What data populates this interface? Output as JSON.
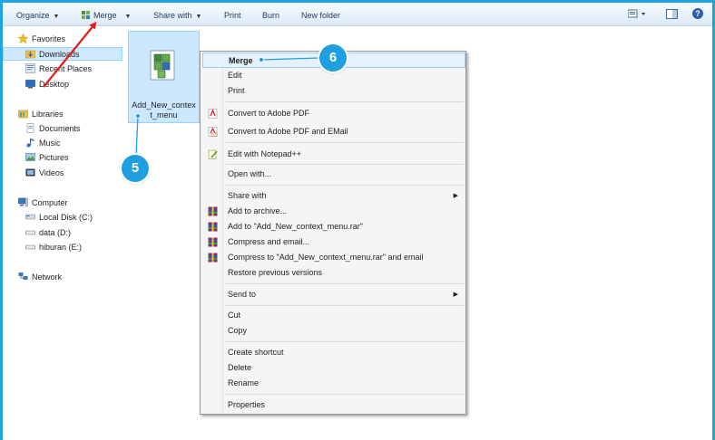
{
  "toolbar": {
    "organize_label": "Organize",
    "merge_label": "Merge",
    "share_label": "Share with",
    "print_label": "Print",
    "burn_label": "Burn",
    "newfolder_label": "New folder",
    "help_label": "?"
  },
  "nav": {
    "favorites": "Favorites",
    "downloads": "Downloads",
    "recent": "Recent Places",
    "desktop": "Desktop",
    "libraries": "Libraries",
    "documents": "Documents",
    "music": "Music",
    "pictures": "Pictures",
    "videos": "Videos",
    "computer": "Computer",
    "localdisk": "Local Disk (C:)",
    "data": "data (D:)",
    "hiburan": "hiburan (E:)",
    "network": "Network"
  },
  "file": {
    "name_line1": "Add_New_contex",
    "name_line2": "t_menu"
  },
  "menu": {
    "merge": "Merge",
    "edit": "Edit",
    "print": "Print",
    "convert_pdf": "Convert to Adobe PDF",
    "convert_pdf_email": "Convert to Adobe PDF and EMail",
    "edit_notepad": "Edit with Notepad++",
    "open_with": "Open with...",
    "share_with": "Share with",
    "add_archive": "Add to archive...",
    "add_rar": "Add to \"Add_New_context_menu.rar\"",
    "compress_email": "Compress and email...",
    "compress_rar_email": "Compress to \"Add_New_context_menu.rar\" and email",
    "restore": "Restore previous versions",
    "send_to": "Send to",
    "cut": "Cut",
    "copy": "Copy",
    "create_shortcut": "Create shortcut",
    "delete": "Delete",
    "rename": "Rename",
    "properties": "Properties"
  },
  "callouts": {
    "step5": "5",
    "step6": "6"
  },
  "colors": {
    "accent": "#1e9fe0",
    "arrow": "#e02020",
    "selection": "#cce8ff"
  }
}
